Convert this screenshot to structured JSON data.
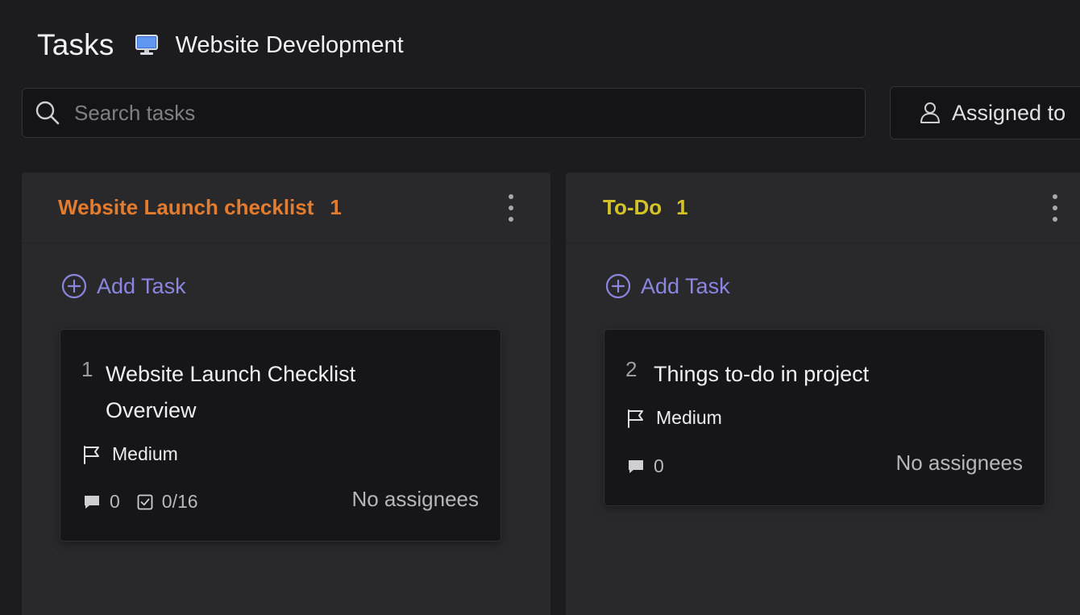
{
  "header": {
    "title": "Tasks",
    "project_icon": "computer-icon",
    "project_name": "Website Development"
  },
  "search": {
    "placeholder": "Search tasks",
    "value": "",
    "icon": "search-icon"
  },
  "filter": {
    "assigned_label": "Assigned to",
    "icon": "user-icon"
  },
  "columns": [
    {
      "title": "Website Launch checklist",
      "count": "1",
      "color": "#e37c2e",
      "add_task_label": "Add Task",
      "cards": [
        {
          "number": "1",
          "title": "Website Launch Checklist Overview",
          "priority": "Medium",
          "comments": "0",
          "checklist": "0/16",
          "assignees": "No assignees"
        }
      ]
    },
    {
      "title": "To-Do",
      "count": "1",
      "color": "#d4c326",
      "add_task_label": "Add Task",
      "cards": [
        {
          "number": "2",
          "title": "Things to-do in project",
          "priority": "Medium",
          "comments": "0",
          "assignees": "No assignees"
        }
      ]
    }
  ],
  "colors": {
    "background": "#1c1c1e",
    "column_bg": "#29292c",
    "card_bg": "#161618",
    "accent": "#8b86e0"
  }
}
